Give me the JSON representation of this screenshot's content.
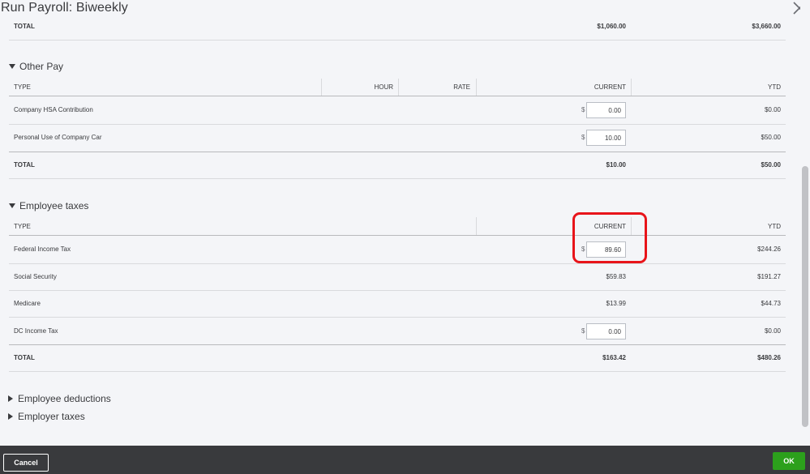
{
  "dialog": {
    "title": "Run Payroll: Biweekly",
    "close_icon": "close-icon"
  },
  "earnings_total": {
    "label": "TOTAL",
    "current": "$1,060.00",
    "ytd": "$3,660.00"
  },
  "other_pay": {
    "title": "Other Pay",
    "columns": {
      "type": "TYPE",
      "hour": "HOUR",
      "rate": "RATE",
      "current": "CURRENT",
      "ytd": "YTD"
    },
    "rows": [
      {
        "type": "Company HSA Contribution",
        "currency": "$",
        "current": "0.00",
        "ytd": "$0.00"
      },
      {
        "type": "Personal Use of Company Car",
        "currency": "$",
        "current": "10.00",
        "ytd": "$50.00"
      }
    ],
    "total": {
      "label": "TOTAL",
      "current": "$10.00",
      "ytd": "$50.00"
    }
  },
  "employee_taxes": {
    "title": "Employee taxes",
    "columns": {
      "type": "TYPE",
      "current": "CURRENT",
      "ytd": "YTD"
    },
    "rows": [
      {
        "type": "Federal Income Tax",
        "currency": "$",
        "current": "89.60",
        "ytd": "$244.26"
      },
      {
        "type": "Social Security",
        "current": "$59.83",
        "ytd": "$191.27"
      },
      {
        "type": "Medicare",
        "current": "$13.99",
        "ytd": "$44.73"
      },
      {
        "type": "DC Income Tax",
        "currency": "$",
        "current": "0.00",
        "ytd": "$0.00"
      }
    ],
    "total": {
      "label": "TOTAL",
      "current": "$163.42",
      "ytd": "$480.26"
    }
  },
  "collapsed_sections": {
    "employee_deductions": "Employee deductions",
    "employer_taxes": "Employer taxes"
  },
  "footer": {
    "cancel_label": "Cancel",
    "ok_label": "OK"
  },
  "colors": {
    "highlight": "#e8141a",
    "ok_button": "#2ca01c",
    "footer_bg": "#393a3d"
  }
}
